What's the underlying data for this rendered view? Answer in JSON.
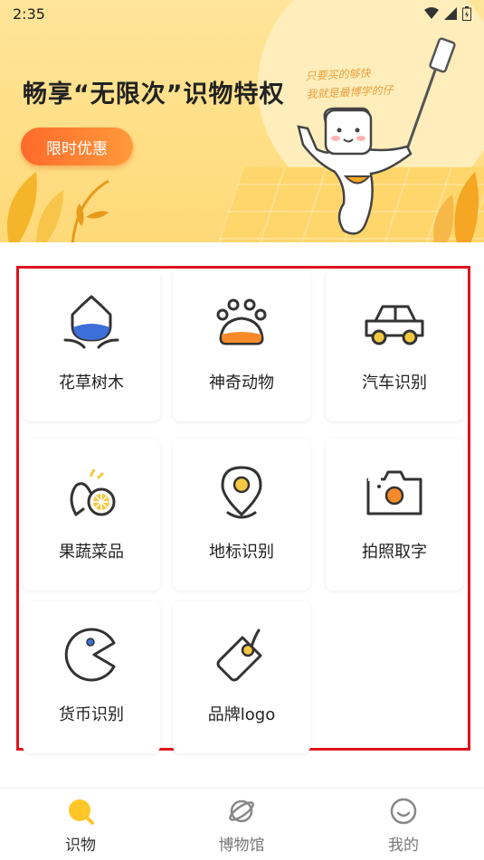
{
  "status_bar": {
    "time": "2:35"
  },
  "banner": {
    "title": "畅享“无限次”识物特权",
    "button": "限时优惠",
    "note_line1": "只要买的够快",
    "note_line2": "我就是最博学的仔"
  },
  "categories": [
    {
      "label": "花草树木",
      "icon": "flower-icon"
    },
    {
      "label": "神奇动物",
      "icon": "paw-icon"
    },
    {
      "label": "汽车识别",
      "icon": "car-icon"
    },
    {
      "label": "果蔬菜品",
      "icon": "fruit-icon"
    },
    {
      "label": "地标识别",
      "icon": "location-pin-icon"
    },
    {
      "label": "拍照取字",
      "icon": "camera-icon"
    },
    {
      "label": "货币识别",
      "icon": "coin-icon"
    },
    {
      "label": "品牌logo",
      "icon": "tag-icon"
    }
  ],
  "nav": [
    {
      "label": "识物",
      "icon": "search-icon",
      "active": true
    },
    {
      "label": "博物馆",
      "icon": "planet-icon",
      "active": false
    },
    {
      "label": "我的",
      "icon": "smile-icon",
      "active": false
    }
  ],
  "colors": {
    "accent": "#ffc627",
    "orange": "#f58a2a",
    "blue": "#3d6fd8",
    "highlight_border": "#e0141e"
  }
}
